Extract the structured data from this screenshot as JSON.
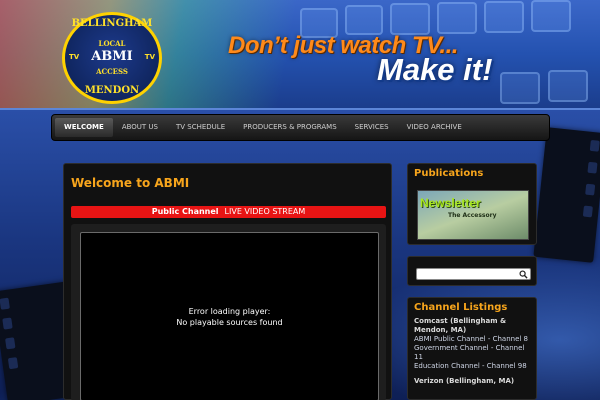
{
  "header": {
    "logo": {
      "top_text": "BELLINGHAM",
      "local": "LOCAL",
      "abmi": "ABMI",
      "access": "ACCESS",
      "bottom_text": "MENDON",
      "tv_left": "TV",
      "tv_right": "TV"
    },
    "tagline_1": "Don’t just watch TV...",
    "tagline_2": "Make it!"
  },
  "nav": {
    "items": [
      {
        "label": "WELCOME",
        "active": true
      },
      {
        "label": "ABOUT US"
      },
      {
        "label": "TV SCHEDULE"
      },
      {
        "label": "PRODUCERS & PROGRAMS"
      },
      {
        "label": "SERVICES"
      },
      {
        "label": "VIDEO ARCHIVE"
      }
    ]
  },
  "main": {
    "title": "Welcome to ABMI",
    "live_bar": {
      "channel": "Public Channel",
      "text": "LIVE VIDEO STREAM"
    },
    "player": {
      "error_line_1": "Error loading player:",
      "error_line_2": "No playable sources found"
    }
  },
  "sidebar": {
    "publications": {
      "title": "Publications",
      "image_title": "Newsletter",
      "image_subtitle": "The Accessory"
    },
    "search": {
      "placeholder": ""
    },
    "channels": {
      "title": "Channel Listings",
      "groups": [
        {
          "provider": "Comcast (Bellingham & Mendon, MA)",
          "lines": [
            "ABMI Public Channel - Channel 8",
            "Government Channel - Channel 11",
            "Education Channel - Channel 98"
          ]
        },
        {
          "provider": "Verizon (Bellingham, MA)",
          "lines": []
        }
      ]
    }
  },
  "colors": {
    "accent": "#f7a51c",
    "live_bar": "#e81414",
    "nav_bg": "#151515"
  }
}
